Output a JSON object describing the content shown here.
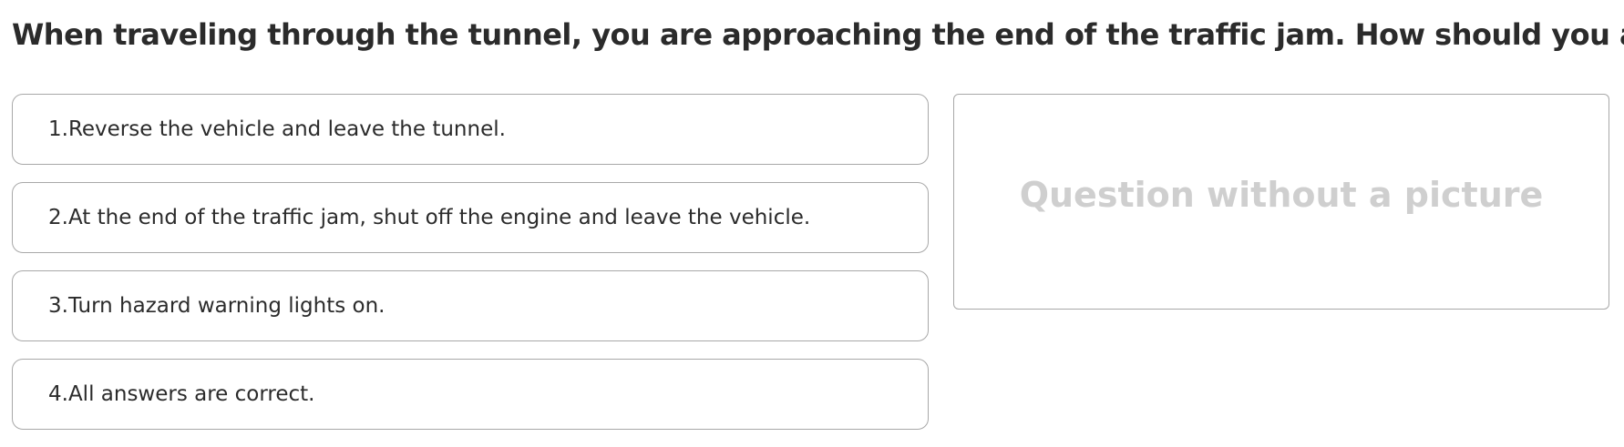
{
  "question": {
    "title": "When traveling through the tunnel, you are approaching the end of the traffic jam. How should you act?"
  },
  "answers": [
    {
      "label": "1.Reverse the vehicle and leave the tunnel."
    },
    {
      "label": "2.At the end of the traffic jam, shut off the engine and leave the vehicle."
    },
    {
      "label": "3.Turn hazard warning lights on."
    },
    {
      "label": "4.All answers are correct."
    }
  ],
  "picture": {
    "placeholder_text": "Question without a picture"
  },
  "colors": {
    "text": "#2b2b2b",
    "border": "#a8a8a8",
    "placeholder": "#cfcfcf"
  }
}
